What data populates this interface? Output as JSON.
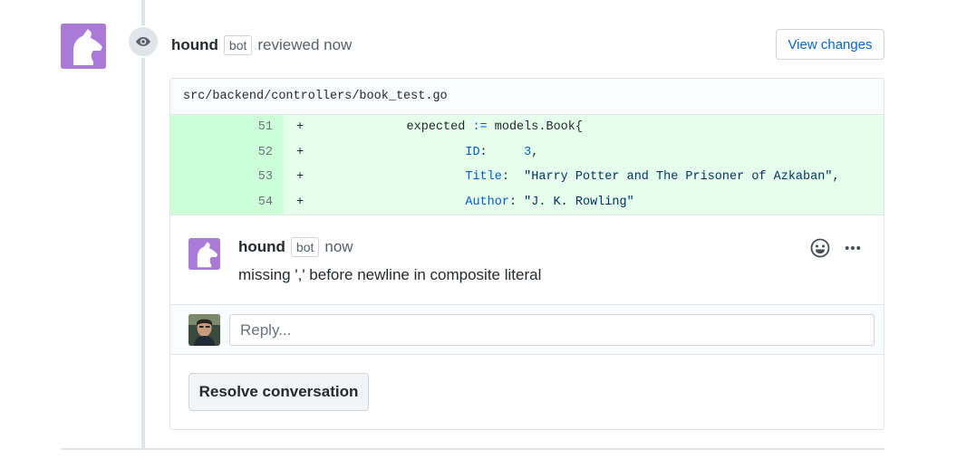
{
  "review": {
    "author": "hound",
    "bot_label": "bot",
    "action": "reviewed now",
    "view_changes_label": "View changes"
  },
  "file": {
    "path": "src/backend/controllers/book_test.go",
    "lines": [
      {
        "number": "51",
        "sign": "+",
        "indent": "              ",
        "key": "",
        "sep": "",
        "value": "",
        "raw_prefix": "expected ",
        "op": ":=",
        "rest": " models.Book{"
      },
      {
        "number": "52",
        "sign": "+",
        "indent": "                      ",
        "key": "ID",
        "sep": ":     ",
        "value": "3",
        "tail": ","
      },
      {
        "number": "53",
        "sign": "+",
        "indent": "                      ",
        "key": "Title",
        "sep": ":  ",
        "value": "\"Harry Potter and The Prisoner of Azkaban\"",
        "tail": ","
      },
      {
        "number": "54",
        "sign": "+",
        "indent": "                      ",
        "key": "Author",
        "sep": ": ",
        "value": "\"J. K. Rowling\"",
        "tail": ""
      }
    ]
  },
  "comment": {
    "author": "hound",
    "bot_label": "bot",
    "time": "now",
    "body": "missing ',' before newline in composite literal"
  },
  "reply": {
    "placeholder": "Reply..."
  },
  "resolve": {
    "label": "Resolve conversation"
  },
  "icons": {
    "review": "eye-icon",
    "emoji": "smiley-icon",
    "more": "kebab-horizontal-icon"
  },
  "colors": {
    "hound_avatar": "#a97bd6",
    "link": "#0366d6",
    "diff_add_bg": "#e6ffed",
    "diff_add_num_bg": "#cdffd8"
  }
}
